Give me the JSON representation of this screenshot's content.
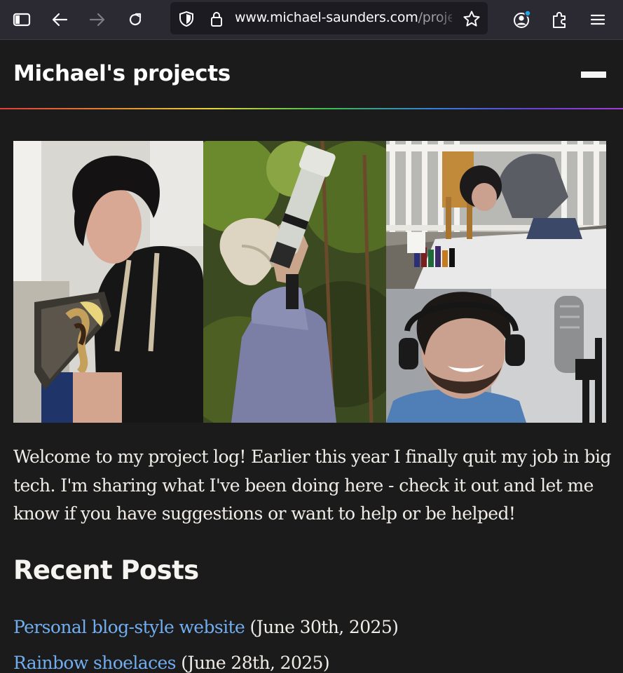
{
  "browser": {
    "url_host": "www.michael-saunders.com",
    "url_path": "/projec",
    "icons": {
      "sidebar": "sidebar-icon",
      "back": "back-arrow-icon",
      "forward": "forward-arrow-icon",
      "reload": "reload-icon",
      "shield": "tracking-shield-icon",
      "lock": "lock-icon",
      "bookmark": "bookmark-star-icon",
      "account": "account-icon",
      "extensions": "extensions-puzzle-icon",
      "menu": "hamburger-menu-icon"
    }
  },
  "site": {
    "title": "Michael's projects",
    "accent_link_color": "#71aef0",
    "background": "#1c1b1c"
  },
  "collage": {
    "photos": [
      "baking-photo",
      "birding-camera-photo",
      "tie-dye-photo",
      "podcast-microphone-photo"
    ]
  },
  "intro": {
    "text": "Welcome to my project log! Earlier this year I finally quit my job in big tech. I'm sharing what I've been doing here - check it out and let me know if you have suggestions or want to help or be helped!"
  },
  "recent_posts": {
    "heading": "Recent Posts",
    "items": [
      {
        "title": "Personal blog-style website",
        "date": "(June 30th, 2025)"
      },
      {
        "title": "Rainbow shoelaces",
        "date": "(June 28th, 2025)"
      }
    ]
  }
}
